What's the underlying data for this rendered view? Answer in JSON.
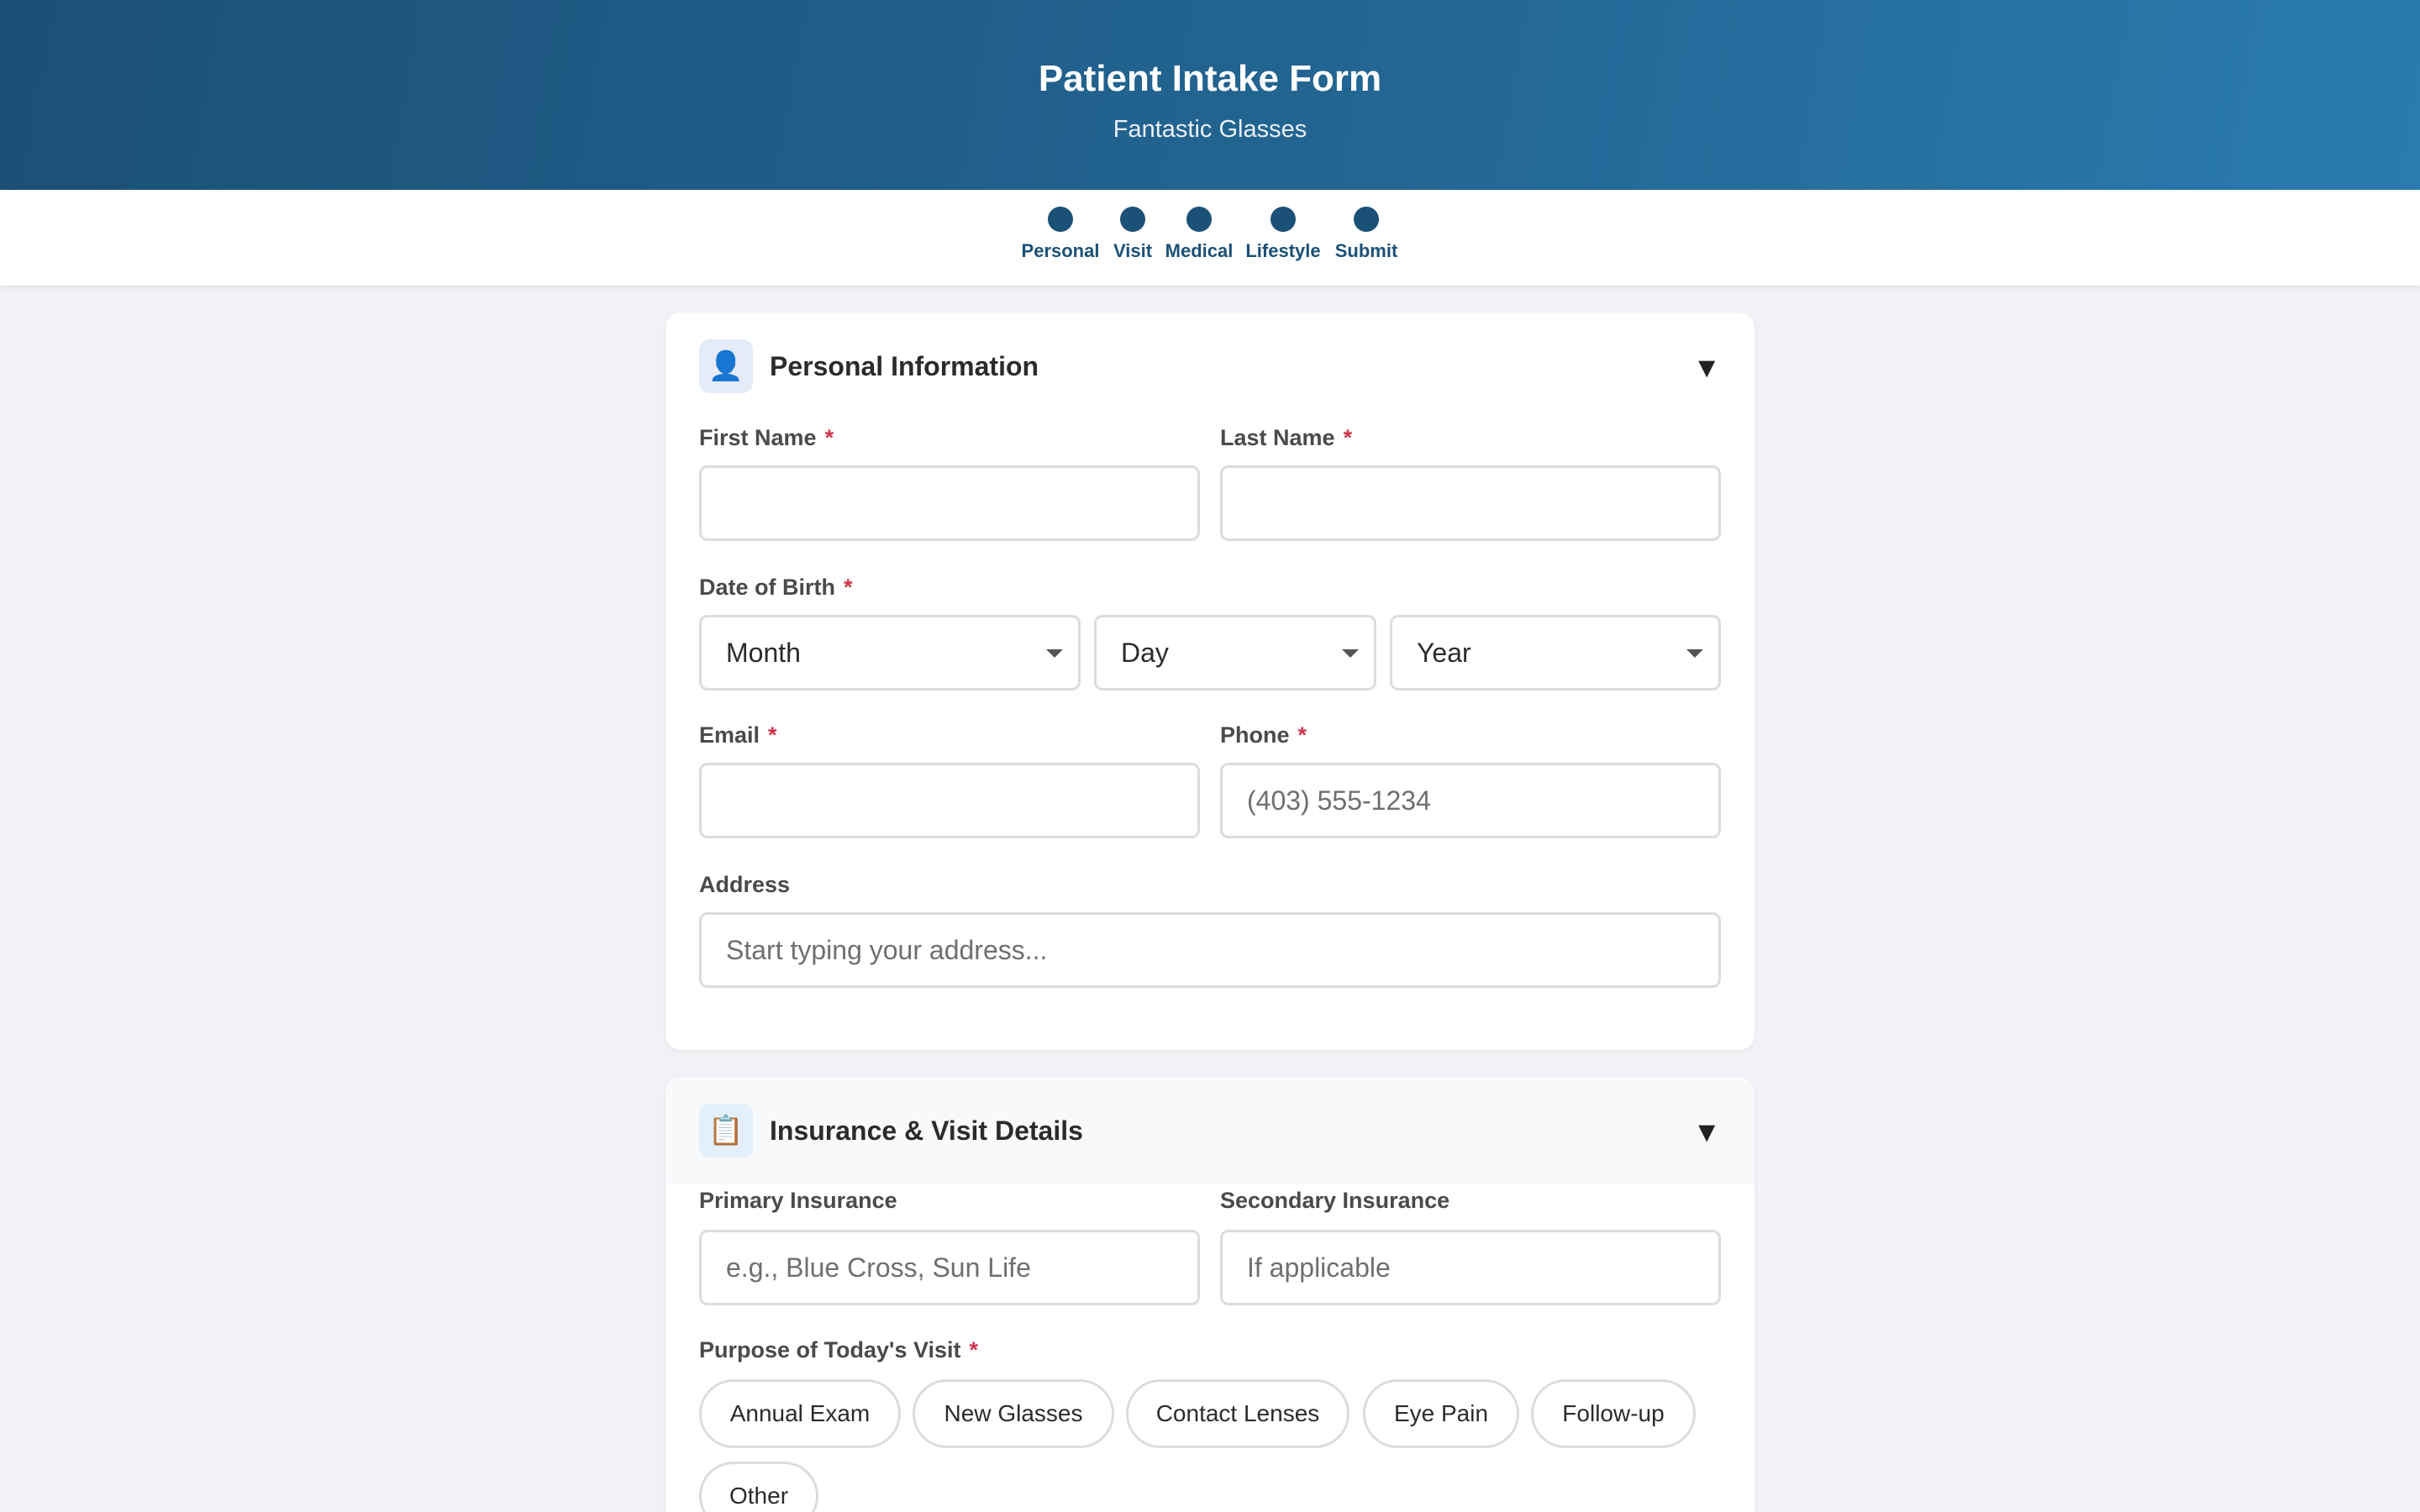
{
  "header": {
    "title": "Patient Intake Form",
    "subtitle": "Fantastic Glasses"
  },
  "steps": [
    {
      "label": "Personal"
    },
    {
      "label": "Visit"
    },
    {
      "label": "Medical"
    },
    {
      "label": "Lifestyle"
    },
    {
      "label": "Submit"
    }
  ],
  "personal": {
    "icon": "👤",
    "icon_name": "person-icon",
    "title": "Personal Information",
    "collapse_glyph": "▼",
    "required_mark": "*",
    "first_name": {
      "label": "First Name",
      "value": "",
      "placeholder": ""
    },
    "last_name": {
      "label": "Last Name",
      "value": "",
      "placeholder": ""
    },
    "dob": {
      "label": "Date of Birth",
      "month": "Month",
      "day": "Day",
      "year": "Year"
    },
    "email": {
      "label": "Email",
      "value": "",
      "placeholder": ""
    },
    "phone": {
      "label": "Phone",
      "value": "",
      "placeholder": "(403) 555-1234"
    },
    "address": {
      "label": "Address",
      "value": "",
      "placeholder": "Start typing your address..."
    }
  },
  "visit": {
    "icon": "📋",
    "icon_name": "clipboard-icon",
    "title": "Insurance & Visit Details",
    "collapse_glyph": "▼",
    "required_mark": "*",
    "primary_insurance": {
      "label": "Primary Insurance",
      "value": "",
      "placeholder": "e.g., Blue Cross, Sun Life"
    },
    "secondary_insurance": {
      "label": "Secondary Insurance",
      "value": "",
      "placeholder": "If applicable"
    },
    "purpose": {
      "label": "Purpose of Today's Visit",
      "options": [
        "Annual Exam",
        "New Glasses",
        "Contact Lenses",
        "Eye Pain",
        "Follow-up",
        "Other"
      ]
    }
  },
  "colors": {
    "header_start": "#1b5077",
    "header_end": "#2a7bb0",
    "step_dot": "#1b5077",
    "required": "#d0324a",
    "background": "#f0f2f5"
  }
}
